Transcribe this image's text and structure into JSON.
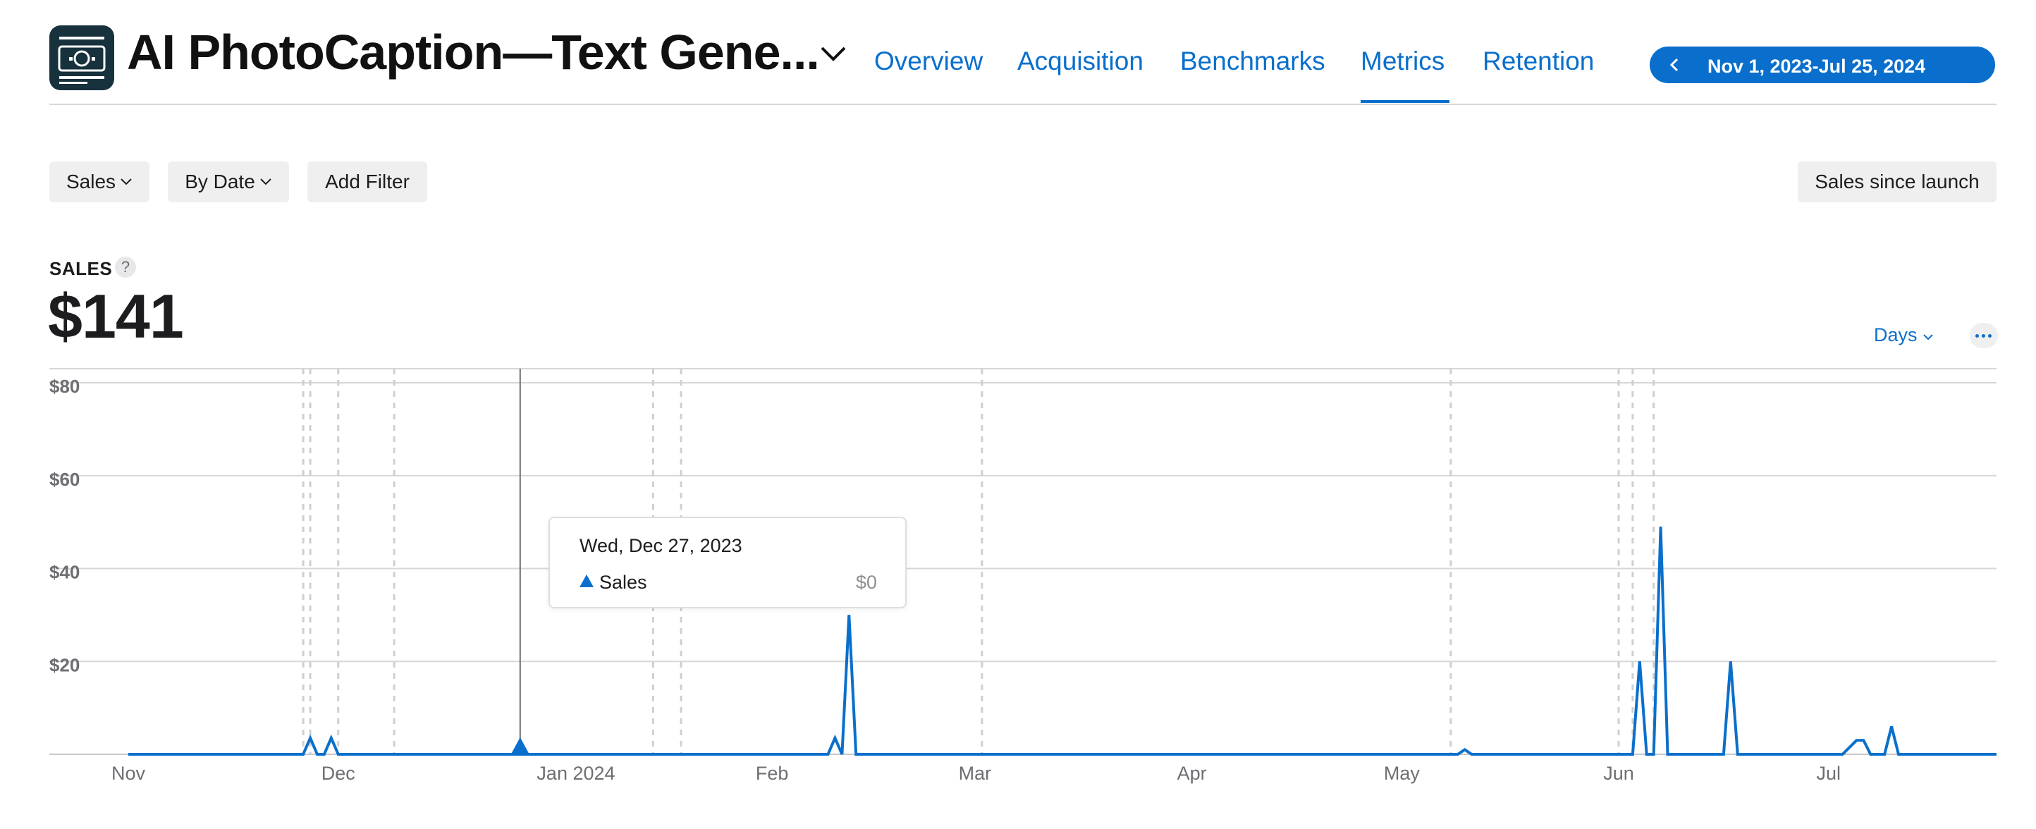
{
  "header": {
    "app_title": "AI PhotoCaption—Text Gene...",
    "app_icon": "camera-document-icon",
    "tabs": [
      {
        "label": "Overview",
        "active": false
      },
      {
        "label": "Acquisition",
        "active": false
      },
      {
        "label": "Benchmarks",
        "active": false
      },
      {
        "label": "Metrics",
        "active": true
      },
      {
        "label": "Retention",
        "active": false
      }
    ],
    "date_range": "Nov 1, 2023-Jul 25, 2024",
    "accent_color": "#0a6fcc"
  },
  "filters": {
    "measure": "Sales",
    "group_by": "By Date",
    "add_filter": "Add Filter",
    "sales_since_launch": "Sales since launch"
  },
  "metric": {
    "label": "SALES",
    "help": "?",
    "value": "$141",
    "granularity": "Days"
  },
  "tooltip": {
    "date": "Wed, Dec 27, 2023",
    "series": "Sales",
    "value": "$0"
  },
  "chart_data": {
    "type": "line",
    "series": [
      {
        "name": "Sales",
        "color": "#0a6fcc",
        "points": [
          [
            "2023-11-01",
            0
          ],
          [
            "2023-11-26",
            0
          ],
          [
            "2023-11-27",
            3.5
          ],
          [
            "2023-11-28",
            0
          ],
          [
            "2023-11-29",
            0
          ],
          [
            "2023-11-30",
            3.5
          ],
          [
            "2023-12-01",
            0
          ],
          [
            "2024-02-09",
            0
          ],
          [
            "2024-02-10",
            3.5
          ],
          [
            "2024-02-11",
            0
          ],
          [
            "2024-02-12",
            30
          ],
          [
            "2024-02-13",
            0
          ],
          [
            "2024-05-09",
            0
          ],
          [
            "2024-05-10",
            1
          ],
          [
            "2024-05-11",
            0
          ],
          [
            "2024-06-03",
            0
          ],
          [
            "2024-06-04",
            20
          ],
          [
            "2024-06-05",
            0
          ],
          [
            "2024-06-06",
            0
          ],
          [
            "2024-06-07",
            49
          ],
          [
            "2024-06-08",
            0
          ],
          [
            "2024-06-16",
            0
          ],
          [
            "2024-06-17",
            20
          ],
          [
            "2024-06-18",
            0
          ],
          [
            "2024-07-03",
            0
          ],
          [
            "2024-07-05",
            3
          ],
          [
            "2024-07-06",
            3
          ],
          [
            "2024-07-07",
            0
          ],
          [
            "2024-07-08",
            0
          ],
          [
            "2024-07-09",
            0
          ],
          [
            "2024-07-10",
            6
          ],
          [
            "2024-07-11",
            0
          ],
          [
            "2024-07-25",
            0
          ]
        ]
      }
    ],
    "y_ticks": [
      "$20",
      "$40",
      "$60",
      "$80"
    ],
    "y_tick_values": [
      20,
      40,
      60,
      80
    ],
    "ylim": [
      0,
      80
    ],
    "x_ticks": [
      "Nov",
      "Dec",
      "Jan 2024",
      "Feb",
      "Mar",
      "Apr",
      "May",
      "Jun",
      "Jul"
    ],
    "x_tick_dates": [
      "2023-11-01",
      "2023-12-01",
      "2024-01-01",
      "2024-02-01",
      "2024-03-01",
      "2024-04-01",
      "2024-05-01",
      "2024-06-01",
      "2024-07-01"
    ],
    "xlim": [
      "2023-11-01",
      "2024-07-25"
    ],
    "event_markers": [
      "2023-11-26",
      "2023-11-27",
      "2023-12-01",
      "2023-12-09",
      "2024-01-15",
      "2024-01-19",
      "2024-03-02",
      "2024-05-08",
      "2024-06-01",
      "2024-06-03",
      "2024-06-06"
    ],
    "selected_date": "2023-12-27",
    "grid": true
  }
}
